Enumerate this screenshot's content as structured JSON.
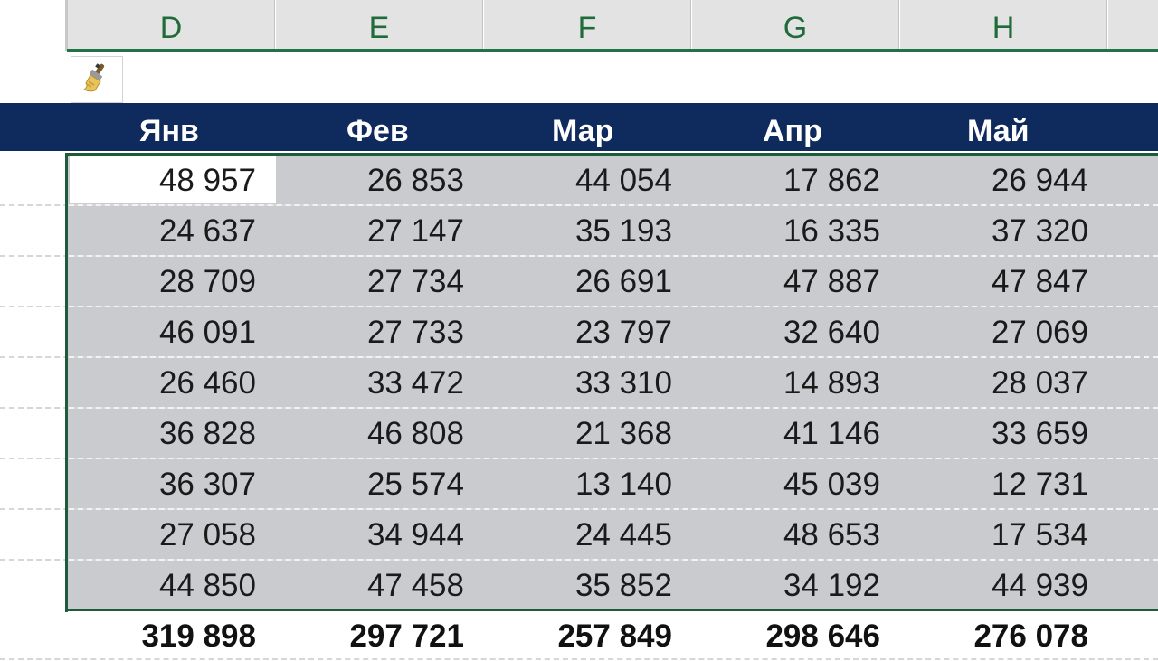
{
  "column_headers": [
    "D",
    "E",
    "F",
    "G",
    "H"
  ],
  "months": [
    "Янв",
    "Фев",
    "Мар",
    "Апр",
    "Май"
  ],
  "rows": [
    [
      "48 957",
      "26 853",
      "44 054",
      "17 862",
      "26 944"
    ],
    [
      "24 637",
      "27 147",
      "35 193",
      "16 335",
      "37 320"
    ],
    [
      "28 709",
      "27 734",
      "26 691",
      "47 887",
      "47 847"
    ],
    [
      "46 091",
      "27 733",
      "23 797",
      "32 640",
      "27 069"
    ],
    [
      "26 460",
      "33 472",
      "33 310",
      "14 893",
      "28 037"
    ],
    [
      "36 828",
      "46 808",
      "21 368",
      "41 146",
      "33 659"
    ],
    [
      "36 307",
      "25 574",
      "13 140",
      "45 039",
      "12 731"
    ],
    [
      "27 058",
      "34 944",
      "24 445",
      "48 653",
      "17 534"
    ],
    [
      "44 850",
      "47 458",
      "35 852",
      "34 192",
      "44 939"
    ]
  ],
  "totals": [
    "319 898",
    "297 721",
    "257 849",
    "298 646",
    "276 078"
  ],
  "icons": {
    "paste_options": "paintbrush-icon"
  },
  "colors": {
    "header_fill": "#0f2a5c",
    "selection_fill": "#c9cbce",
    "selection_border": "#1e5b3c",
    "column_header_text": "#1f6b3a"
  }
}
